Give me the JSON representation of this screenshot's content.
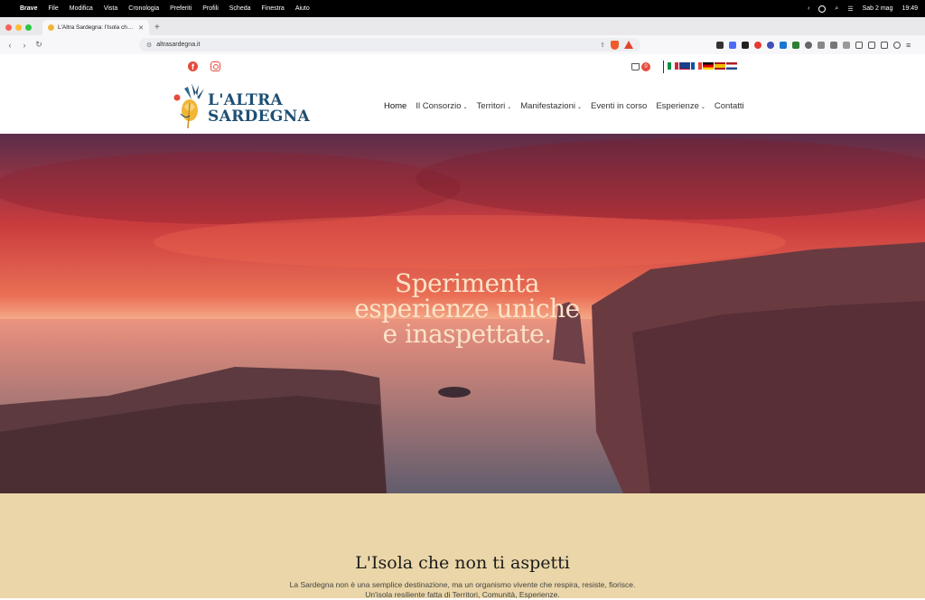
{
  "menubar": {
    "items": [
      "Brave",
      "File",
      "Modifica",
      "Vista",
      "Cronologia",
      "Preferiti",
      "Profili",
      "Scheda",
      "Finestra",
      "Aiuto"
    ],
    "date": "Sab 2 mag",
    "time": "19:49"
  },
  "browser": {
    "tab_title": "L'Altra Sardegna: l'Isola che n",
    "url": "altrasardegna.it",
    "shield_count": "1"
  },
  "site": {
    "cart_count": "0",
    "logo_line1": "L'ALTRA",
    "logo_line2": "SARDEGNA",
    "nav": {
      "home": "Home",
      "consorzio": "Il Consorzio",
      "territori": "Territori",
      "manifestazioni": "Manifestazioni",
      "eventi": "Eventi in corso",
      "esperienze": "Esperienze",
      "contatti": "Contatti"
    },
    "hero": {
      "line1": "Sperimenta",
      "line2": "esperienze uniche",
      "line3": "e inaspettate."
    },
    "section": {
      "title": "L'Isola che non ti aspetti",
      "line1": "La Sardegna non è una semplice destinazione, ma un organismo vivente che respira, resiste, fiorisce.",
      "line2": "Un'isola resiliente fatta di Territori, Comunità, Esperienze."
    }
  },
  "colors": {
    "accent_red": "#e64b3c",
    "logo_blue": "#1f4f73",
    "beige": "#ead6a8"
  }
}
